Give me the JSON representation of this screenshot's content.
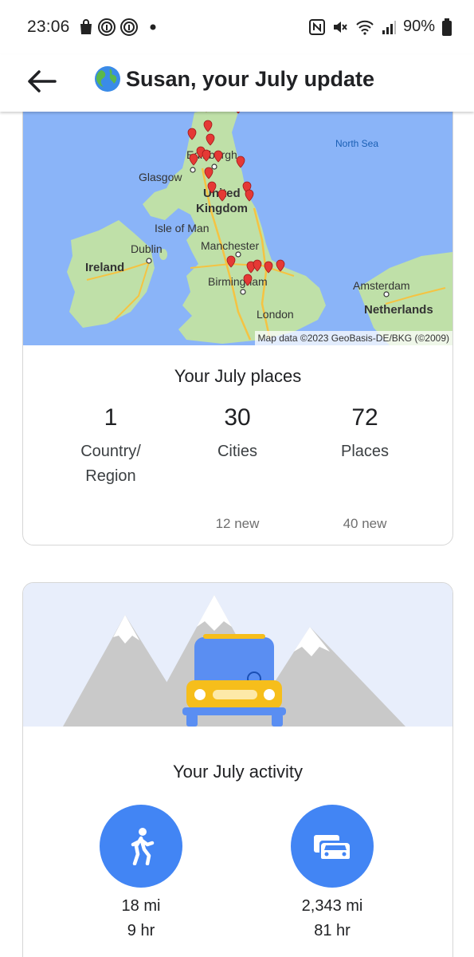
{
  "status_bar": {
    "time": "23:06",
    "battery": "90%",
    "icons": [
      "shopping-bag-icon",
      "fingerprint-icon",
      "fingerprint-icon",
      "dot-icon",
      "nfc-icon",
      "mute-icon",
      "wifi-icon",
      "signal-icon",
      "battery-icon"
    ]
  },
  "header": {
    "back_icon": "arrow-left-icon",
    "emoji": "🌍",
    "title": "Susan, your July update"
  },
  "map": {
    "labels": {
      "north_sea": "North Sea",
      "edinburgh": "Edinburgh",
      "glasgow": "Glasgow",
      "uk_line1": "United",
      "uk_line2": "Kingdom",
      "isle_of_man": "Isle of Man",
      "dublin": "Dublin",
      "ireland": "Ireland",
      "manchester": "Manchester",
      "birmingham": "Birmingham",
      "london": "London",
      "amsterdam": "Amsterdam",
      "netherlands": "Netherlands"
    },
    "attribution": "Map data ©2023 GeoBasis-DE/BKG (©2009)",
    "colors": {
      "water": "#8ab4f8",
      "land": "#bfe0a8",
      "pin": "#e53935",
      "road": "#f5c342"
    }
  },
  "places": {
    "title": "Your July places",
    "stats": [
      {
        "value": "1",
        "label_line1": "Country/",
        "label_line2": "Region",
        "new": ""
      },
      {
        "value": "30",
        "label_line1": "Cities",
        "label_line2": "",
        "new": "12 new"
      },
      {
        "value": "72",
        "label_line1": "Places",
        "label_line2": "",
        "new": "40 new"
      }
    ]
  },
  "activity": {
    "title": "Your July activity",
    "items": [
      {
        "icon": "walking-icon",
        "distance": "18 mi",
        "time": "9 hr"
      },
      {
        "icon": "driving-icon",
        "distance": "2,343 mi",
        "time": "81 hr"
      }
    ],
    "colors": {
      "circle": "#4285f4",
      "sky": "#e8eefb",
      "car_body": "#5a8ef2",
      "car_front": "#f6be1b"
    }
  }
}
